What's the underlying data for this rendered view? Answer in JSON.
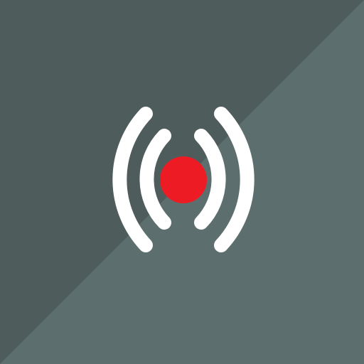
{
  "icon": {
    "name": "live-broadcast-icon",
    "colors": {
      "background_dark": "#4e5c5b",
      "background_light": "#5c6f6e",
      "waves": "#ffffff",
      "dot": "#ed1c24"
    }
  }
}
